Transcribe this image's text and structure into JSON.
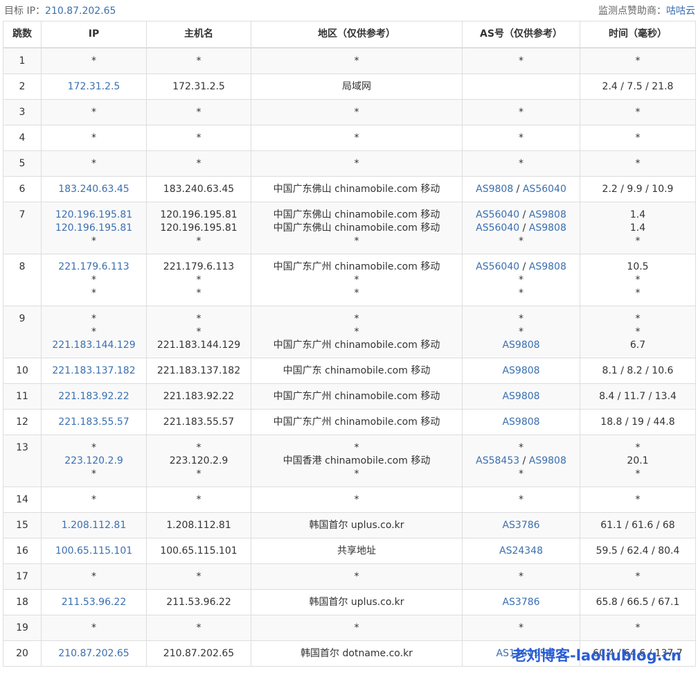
{
  "header": {
    "target_label": "目标 IP：",
    "target_ip": "210.87.202.65",
    "sponsor_label": "监测点赞助商：",
    "sponsor_name": "咕咕云"
  },
  "columns": [
    "跳数",
    "IP",
    "主机名",
    "地区（仅供参考）",
    "AS号（仅供参考）",
    "时间（毫秒）"
  ],
  "hops": [
    {
      "hop": "1",
      "lines": [
        {
          "ip": "*",
          "host": "*",
          "region": "*",
          "as": [
            "*"
          ],
          "time": "*"
        }
      ]
    },
    {
      "hop": "2",
      "lines": [
        {
          "ip": "172.31.2.5",
          "host": "172.31.2.5",
          "region": "局域网",
          "as": [],
          "time": "2.4 / 7.5 / 21.8"
        }
      ]
    },
    {
      "hop": "3",
      "lines": [
        {
          "ip": "*",
          "host": "*",
          "region": "*",
          "as": [
            "*"
          ],
          "time": "*"
        }
      ]
    },
    {
      "hop": "4",
      "lines": [
        {
          "ip": "*",
          "host": "*",
          "region": "*",
          "as": [
            "*"
          ],
          "time": "*"
        }
      ]
    },
    {
      "hop": "5",
      "lines": [
        {
          "ip": "*",
          "host": "*",
          "region": "*",
          "as": [
            "*"
          ],
          "time": "*"
        }
      ]
    },
    {
      "hop": "6",
      "lines": [
        {
          "ip": "183.240.63.45",
          "host": "183.240.63.45",
          "region": "中国广东佛山 chinamobile.com 移动",
          "as": [
            "AS9808",
            "AS56040"
          ],
          "time": "2.2 / 9.9 / 10.9"
        }
      ]
    },
    {
      "hop": "7",
      "lines": [
        {
          "ip": "120.196.195.81",
          "host": "120.196.195.81",
          "region": "中国广东佛山 chinamobile.com 移动",
          "as": [
            "AS56040",
            "AS9808"
          ],
          "time": "1.4"
        },
        {
          "ip": "120.196.195.81",
          "host": "120.196.195.81",
          "region": "中国广东佛山 chinamobile.com 移动",
          "as": [
            "AS56040",
            "AS9808"
          ],
          "time": "1.4"
        },
        {
          "ip": "*",
          "host": "*",
          "region": "*",
          "as": [
            "*"
          ],
          "time": "*"
        }
      ]
    },
    {
      "hop": "8",
      "lines": [
        {
          "ip": "221.179.6.113",
          "host": "221.179.6.113",
          "region": "中国广东广州 chinamobile.com 移动",
          "as": [
            "AS56040",
            "AS9808"
          ],
          "time": "10.5"
        },
        {
          "ip": "*",
          "host": "*",
          "region": "*",
          "as": [
            "*"
          ],
          "time": "*"
        },
        {
          "ip": "*",
          "host": "*",
          "region": "*",
          "as": [
            "*"
          ],
          "time": "*"
        }
      ]
    },
    {
      "hop": "9",
      "lines": [
        {
          "ip": "*",
          "host": "*",
          "region": "*",
          "as": [
            "*"
          ],
          "time": "*"
        },
        {
          "ip": "*",
          "host": "*",
          "region": "*",
          "as": [
            "*"
          ],
          "time": "*"
        },
        {
          "ip": "221.183.144.129",
          "host": "221.183.144.129",
          "region": "中国广东广州 chinamobile.com 移动",
          "as": [
            "AS9808"
          ],
          "time": "6.7"
        }
      ]
    },
    {
      "hop": "10",
      "lines": [
        {
          "ip": "221.183.137.182",
          "host": "221.183.137.182",
          "region": "中国广东 chinamobile.com 移动",
          "as": [
            "AS9808"
          ],
          "time": "8.1 / 8.2 / 10.6"
        }
      ]
    },
    {
      "hop": "11",
      "lines": [
        {
          "ip": "221.183.92.22",
          "host": "221.183.92.22",
          "region": "中国广东广州 chinamobile.com 移动",
          "as": [
            "AS9808"
          ],
          "time": "8.4 / 11.7 / 13.4"
        }
      ]
    },
    {
      "hop": "12",
      "lines": [
        {
          "ip": "221.183.55.57",
          "host": "221.183.55.57",
          "region": "中国广东广州 chinamobile.com 移动",
          "as": [
            "AS9808"
          ],
          "time": "18.8 / 19 / 44.8"
        }
      ]
    },
    {
      "hop": "13",
      "lines": [
        {
          "ip": "*",
          "host": "*",
          "region": "*",
          "as": [
            "*"
          ],
          "time": "*"
        },
        {
          "ip": "223.120.2.9",
          "host": "223.120.2.9",
          "region": "中国香港 chinamobile.com 移动",
          "as": [
            "AS58453",
            "AS9808"
          ],
          "time": "20.1"
        },
        {
          "ip": "*",
          "host": "*",
          "region": "*",
          "as": [
            "*"
          ],
          "time": "*"
        }
      ]
    },
    {
      "hop": "14",
      "lines": [
        {
          "ip": "*",
          "host": "*",
          "region": "*",
          "as": [
            "*"
          ],
          "time": "*"
        }
      ]
    },
    {
      "hop": "15",
      "lines": [
        {
          "ip": "1.208.112.81",
          "host": "1.208.112.81",
          "region": "韩国首尔 uplus.co.kr",
          "as": [
            "AS3786"
          ],
          "time": "61.1 / 61.6 / 68"
        }
      ]
    },
    {
      "hop": "16",
      "lines": [
        {
          "ip": "100.65.115.101",
          "host": "100.65.115.101",
          "region": "共享地址",
          "as": [
            "AS24348"
          ],
          "time": "59.5 / 62.4 / 80.4"
        }
      ]
    },
    {
      "hop": "17",
      "lines": [
        {
          "ip": "*",
          "host": "*",
          "region": "*",
          "as": [
            "*"
          ],
          "time": "*"
        }
      ]
    },
    {
      "hop": "18",
      "lines": [
        {
          "ip": "211.53.96.22",
          "host": "211.53.96.22",
          "region": "韩国首尔 uplus.co.kr",
          "as": [
            "AS3786"
          ],
          "time": "65.8 / 66.5 / 67.1"
        }
      ]
    },
    {
      "hop": "19",
      "lines": [
        {
          "ip": "*",
          "host": "*",
          "region": "*",
          "as": [
            "*"
          ],
          "time": "*"
        }
      ]
    },
    {
      "hop": "20",
      "lines": [
        {
          "ip": "210.87.202.65",
          "host": "210.87.202.65",
          "region": "韩国首尔 dotname.co.kr",
          "as": [
            "AS138195"
          ],
          "time": "60.4 / 64.6 / 137.7"
        }
      ]
    }
  ],
  "watermark": "老刘博客-laoliublog.cn",
  "colors": {
    "link": "#3a6fb0",
    "border": "#dddddd",
    "stripe": "#f9f9f9",
    "watermark": "#2a5dd6"
  }
}
